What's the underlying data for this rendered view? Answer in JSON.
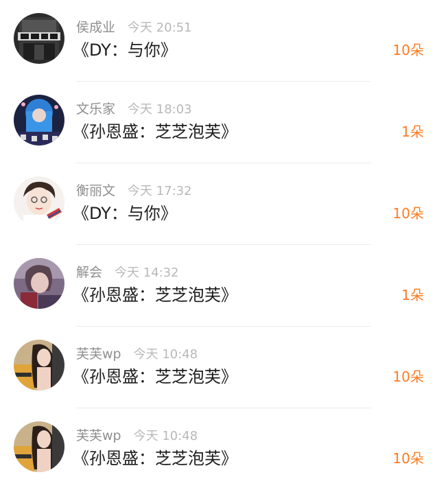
{
  "gifts": [
    {
      "user": "侯成业",
      "time": "今天 20:51",
      "song": "《DY：与你》",
      "count": "10朵",
      "avatar": "avatar-dark-text-icon"
    },
    {
      "user": "文乐家",
      "time": "今天 18:03",
      "song": "《孙恩盛：芝芝泡芙》",
      "count": "1朵",
      "avatar": "avatar-anime-blue-icon"
    },
    {
      "user": "衡丽文",
      "time": "今天 17:32",
      "song": "《DY：与你》",
      "count": "10朵",
      "avatar": "avatar-sketch-boy-icon"
    },
    {
      "user": "解会",
      "time": "今天 14:32",
      "song": "《孙恩盛：芝芝泡芙》",
      "count": "1朵",
      "avatar": "avatar-photo-purple-icon"
    },
    {
      "user": "芙芙wp",
      "time": "今天 10:48",
      "song": "《孙恩盛：芝芝泡芙》",
      "count": "10朵",
      "avatar": "avatar-photo-girl-icon"
    },
    {
      "user": "芙芙wp",
      "time": "今天 10:48",
      "song": "《孙恩盛：芝芝泡芙》",
      "count": "10朵",
      "avatar": "avatar-photo-girl-icon"
    }
  ],
  "colors": {
    "count": "#ff7a1f",
    "song": "#1e1e1e",
    "username": "#8e8e8e",
    "time": "#b8b8b8"
  }
}
